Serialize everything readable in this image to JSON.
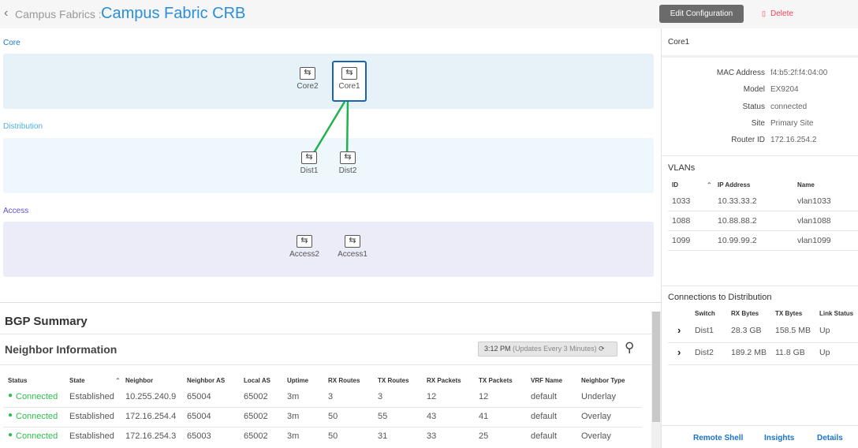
{
  "header": {
    "back_label": "Campus Fabrics :",
    "title": "Campus Fabric CRB",
    "edit_button": "Edit Configuration",
    "delete_button": "Delete"
  },
  "topology": {
    "levels": [
      {
        "label": "Core",
        "color": "#1a73c8",
        "band": "#e6f1f8"
      },
      {
        "label": "Distribution",
        "color": "#4ab3e0",
        "band": "#eef7fb"
      },
      {
        "label": "Access",
        "color": "#5a55c8",
        "band": "#ecebf8"
      }
    ],
    "nodes": {
      "core2": "Core2",
      "core1": "Core1",
      "dist1": "Dist1",
      "dist2": "Dist2",
      "access2": "Access2",
      "access1": "Access1"
    },
    "selected": "Core1",
    "link_color": "#22b14c"
  },
  "bgp": {
    "title": "BGP Summary",
    "subtitle": "Neighbor Information",
    "refresh_time": "3:12 PM",
    "refresh_note": "(Updates Every 3 Minutes)",
    "columns": [
      "Status",
      "State",
      "Neighbor",
      "Neighbor AS",
      "Local AS",
      "Uptime",
      "RX Routes",
      "TX Routes",
      "RX Packets",
      "TX Packets",
      "VRF Name",
      "Neighbor Type"
    ],
    "rows": [
      [
        "Connected",
        "Established",
        "10.255.240.9",
        "65004",
        "65002",
        "3m",
        "3",
        "3",
        "12",
        "12",
        "default",
        "Underlay"
      ],
      [
        "Connected",
        "Established",
        "172.16.254.4",
        "65004",
        "65002",
        "3m",
        "50",
        "55",
        "43",
        "41",
        "default",
        "Overlay"
      ],
      [
        "Connected",
        "Established",
        "172.16.254.3",
        "65003",
        "65002",
        "3m",
        "50",
        "31",
        "33",
        "25",
        "default",
        "Overlay"
      ]
    ]
  },
  "side": {
    "title": "Core1",
    "details": [
      [
        "MAC Address",
        "f4:b5:2f:f4:04:00"
      ],
      [
        "Model",
        "EX9204"
      ],
      [
        "Status",
        "connected"
      ],
      [
        "Site",
        "Primary Site"
      ],
      [
        "Router ID",
        "172.16.254.2"
      ]
    ],
    "vlans": {
      "title": "VLANs",
      "columns": [
        "ID",
        "IP Address",
        "Name"
      ],
      "rows": [
        [
          "1033",
          "10.33.33.2",
          "vlan1033"
        ],
        [
          "1088",
          "10.88.88.2",
          "vlan1088"
        ],
        [
          "1099",
          "10.99.99.2",
          "vlan1099"
        ]
      ]
    },
    "connections": {
      "title": "Connections to Distribution",
      "columns": [
        "Switch",
        "RX Bytes",
        "TX Bytes",
        "Link Status"
      ],
      "rows": [
        [
          "Dist1",
          "28.3 GB",
          "158.5 MB",
          "Up"
        ],
        [
          "Dist2",
          "189.2 MB",
          "11.8 GB",
          "Up"
        ]
      ]
    },
    "footer": [
      "Remote Shell",
      "Insights",
      "Details"
    ]
  }
}
